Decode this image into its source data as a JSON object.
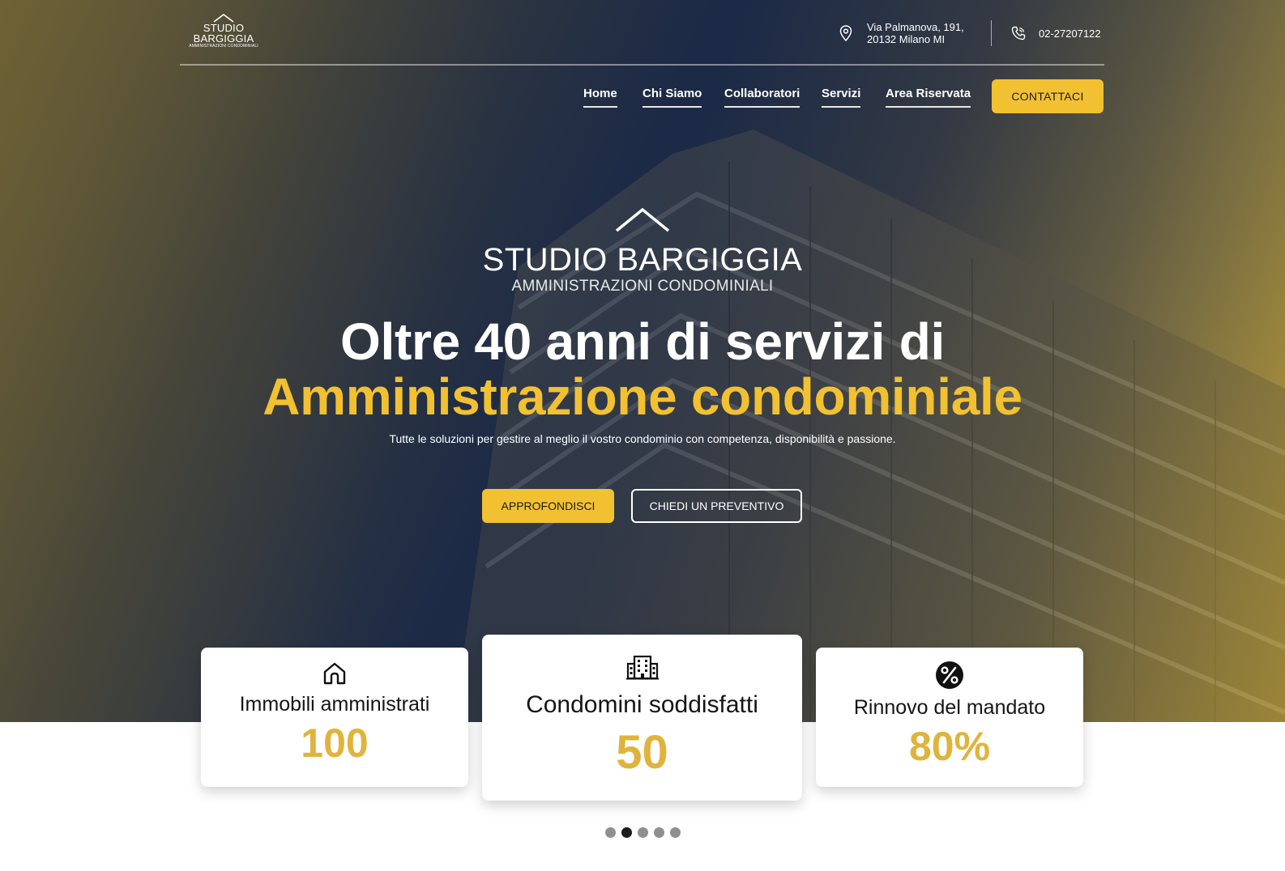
{
  "brand": {
    "logo_small_line1": "STUDIO",
    "logo_small_line2": "BARGIGGIA",
    "logo_small_line3": "AMMINISTRAZIONI CONDOMINIALI",
    "logo_large_name": "STUDIO BARGIGGIA",
    "logo_large_tagline": "AMMINISTRAZIONI CONDOMINIALI"
  },
  "contact": {
    "address_line1": "Via Palmanova, 191,",
    "address_line2": "20132 Milano MI",
    "address_icon": "map-pin-icon",
    "phone": "02-27207122",
    "phone_icon": "phone-icon"
  },
  "nav": {
    "items": [
      {
        "label": "Home"
      },
      {
        "label": "Chi Siamo"
      },
      {
        "label": "Collaboratori"
      },
      {
        "label": "Servizi"
      },
      {
        "label": "Area Riservata"
      }
    ],
    "cta_label": "CONTATTACI"
  },
  "hero": {
    "headline_line1": "Oltre 40 anni di servizi di",
    "headline_line2": "Amministrazione condominiale",
    "subtitle": "Tutte le soluzioni per gestire al meglio il vostro condominio con competenza, disponibilità e passione.",
    "primary_button": "APPROFONDISCI",
    "secondary_button": "CHIEDI UN PREVENTIVO"
  },
  "stats": [
    {
      "icon": "house-icon",
      "title": "Immobili amministrati",
      "value": "100"
    },
    {
      "icon": "building-icon",
      "title": "Condomini soddisfatti",
      "value": "50"
    },
    {
      "icon": "percent-icon",
      "title": "Rinnovo del mandato",
      "value": "80%"
    }
  ],
  "carousel": {
    "total": 5,
    "active_index": 1
  },
  "colors": {
    "accent": "#f2c132",
    "stat_value": "#e0b43c",
    "hero_dark": "#1d2b47"
  }
}
